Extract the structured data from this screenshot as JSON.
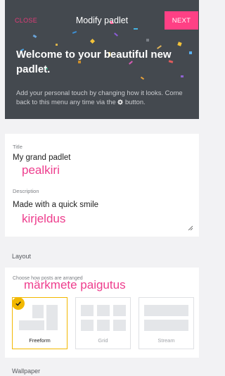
{
  "header": {
    "close_label": "CLOSE",
    "title": "Modify padlet",
    "next_label": "NEXT",
    "welcome_heading": "Welcome to your beautiful new padlet.",
    "help_text_before": "Add your personal touch by changing how it looks. Come back to this menu any time via the",
    "help_text_after": "button.",
    "gear_icon": "gear-icon"
  },
  "form": {
    "title_label": "Title",
    "title_value": "My grand padlet",
    "title_annotation": "pealkiri",
    "description_label": "Description",
    "description_value": "Made with a quick smile",
    "description_annotation": "kirjeldus"
  },
  "layout": {
    "section_label": "Layout",
    "choose_text": "Choose how posts are arranged",
    "annotation": "märkmete paigutus",
    "options": [
      {
        "label": "Freeform",
        "selected": true
      },
      {
        "label": "Grid",
        "selected": false
      },
      {
        "label": "Stream",
        "selected": false
      }
    ]
  },
  "wallpaper": {
    "section_label": "Wallpaper"
  },
  "colors": {
    "accent_pink": "#ff4085",
    "close_pink": "#e23c78",
    "header_bg": "#44494f",
    "annotation_pink": "#ee3d8d",
    "selected_gold": "#f2b800"
  }
}
